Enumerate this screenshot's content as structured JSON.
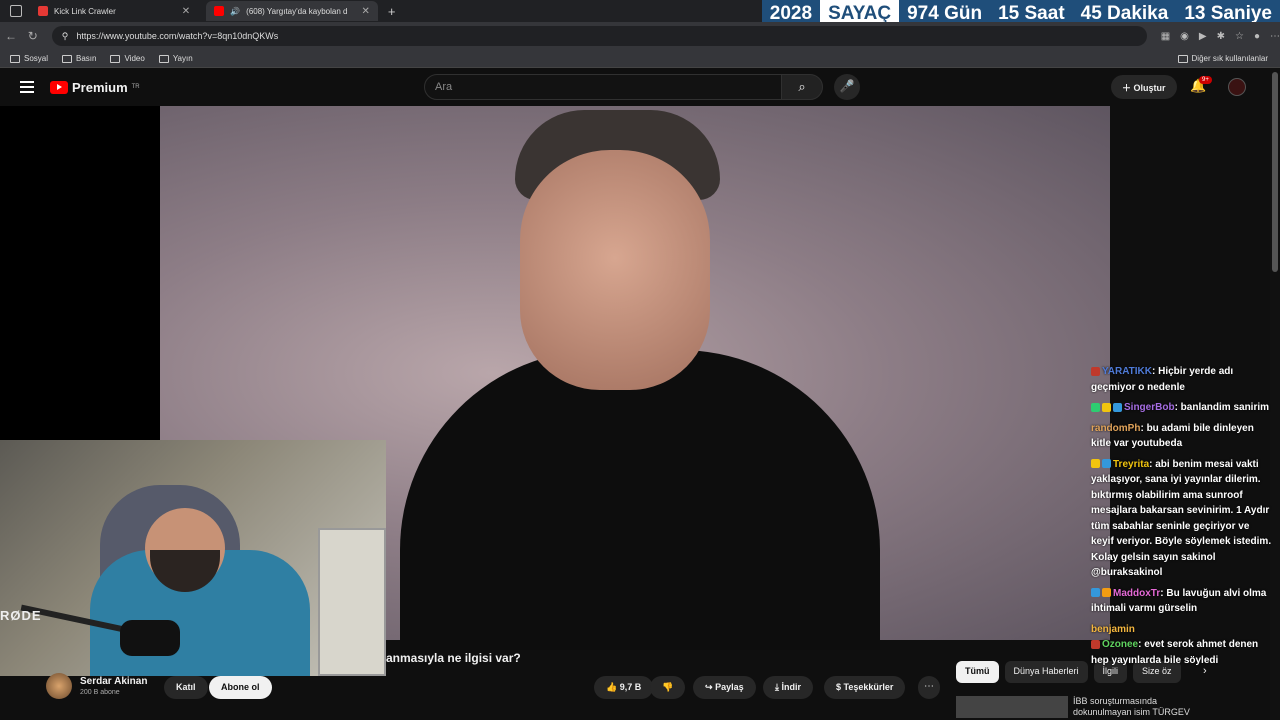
{
  "browser": {
    "tabs": [
      {
        "title": "Kick Link Crawler",
        "color": "#e53935"
      },
      {
        "title": "(608) Yargıtay'da kaybolan d",
        "color": "#ff0000"
      }
    ],
    "url": "https://www.youtube.com/watch?v=8qn10dnQKWs",
    "bookmarks": [
      "Sosyal",
      "Basın",
      "Video",
      "Yayın"
    ],
    "other_bookmarks": "Diğer sık kullanılanlar"
  },
  "banner": {
    "year": "2028",
    "label": "SAYAÇ",
    "days": "974 Gün",
    "hours": "15 Saat",
    "minutes": "45 Dakika",
    "seconds": "13 Saniye"
  },
  "youtube": {
    "logo_text": "Premium",
    "region": "TR",
    "search_placeholder": "Ara",
    "create_label": "Oluştur",
    "notif_count": "9+"
  },
  "video": {
    "title_fragment": "anmasıyla ne ilgisi var?",
    "channel_name": "Serdar Akinan",
    "subscribers": "200 B abone",
    "join_label": "Katıl",
    "subscribe_label": "Abone ol",
    "likes": "9,7 B",
    "share_label": "Paylaş",
    "download_label": "İndir",
    "thanks_label": "Teşekkürler",
    "more_label": "⋯"
  },
  "chips": [
    "Tümü",
    "Dünya Haberleri",
    "İlgili",
    "Size öz"
  ],
  "related": {
    "text_line1": "İBB soruşturmasında",
    "text_line2": "dokunulmayan isim TÜRGEV"
  },
  "webcam": {
    "brand": "RØDE"
  },
  "chat": [
    {
      "user": "YARATIKK",
      "color": "#4f7bd8",
      "text": "Hiçbir yerde adı geçmiyor o nedenle"
    },
    {
      "user": "SingerBob",
      "color": "#a56de2",
      "text": "banlandim sanirim"
    },
    {
      "user": "randomPh",
      "color": "#e0a35a",
      "text": "bu adami bile dinleyen kitle var youtubeda"
    },
    {
      "user": "Treyrita",
      "color": "#f1c40f",
      "text": "abi benim mesai vakti yaklaşıyor, sana iyi yayınlar dilerim. bıktırmış olabilirim ama sunroof mesajlara bakarsan sevinirim. 1 Aydır tüm sabahlar seninle geçiriyor ve keyif veriyor. Böyle söylemek istedim. Kolay gelsin sayın sakinol @buraksakinol"
    },
    {
      "user": "MaddoxTr",
      "color": "#e56ad6",
      "text": "Bu lavuğun alvi olma ihtimali varmı gürselin"
    },
    {
      "user": "benjamin",
      "color": "#f3b63f",
      "text": ""
    },
    {
      "user": "Ozonee",
      "color": "#5fd35f",
      "text": "evet serok ahmet denen hep yayınlarda bile söyledi"
    }
  ]
}
